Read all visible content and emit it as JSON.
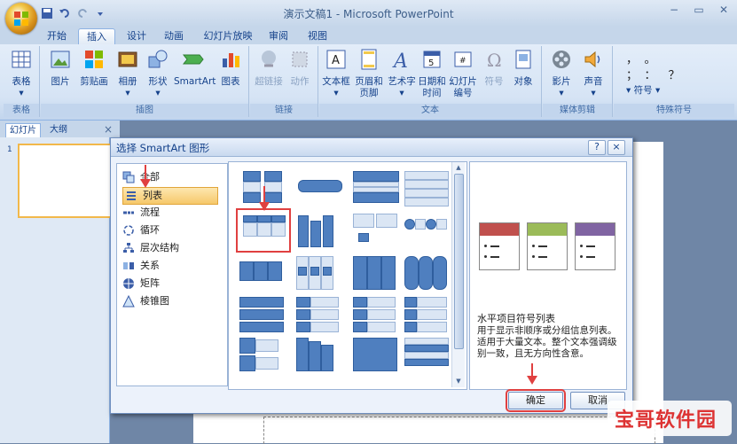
{
  "window": {
    "title": "演示文稿1 - Microsoft PowerPoint",
    "controls": [
      "−",
      "▭",
      "✕"
    ]
  },
  "tabs": [
    "开始",
    "插入",
    "设计",
    "动画",
    "幻灯片放映",
    "审阅",
    "视图"
  ],
  "ribbon": {
    "groups": [
      {
        "label": "表格",
        "buttons": [
          "表格"
        ]
      },
      {
        "label": "插图",
        "buttons": [
          "图片",
          "剪贴画",
          "相册",
          "形状",
          "SmartArt",
          "图表"
        ]
      },
      {
        "label": "链接",
        "buttons": [
          "超链接",
          "动作"
        ]
      },
      {
        "label": "文本",
        "buttons": [
          "文本框",
          "页眉和\n页脚",
          "艺术字",
          "日期和\n时间",
          "幻灯片\n编号",
          "符号",
          "对象"
        ]
      },
      {
        "label": "媒体剪辑",
        "buttons": [
          "影片",
          "声音"
        ]
      },
      {
        "label": "特殊符号",
        "buttons": [
          "符号"
        ]
      }
    ],
    "special_symbols": [
      "，",
      "。",
      "；",
      "：",
      "？"
    ]
  },
  "left_pane": {
    "tabs": [
      "幻灯片",
      "大纲"
    ],
    "close": "×",
    "slide_number": "1"
  },
  "dialog": {
    "title": "选择 SmartArt 图形",
    "help": "?",
    "close": "×",
    "categories": [
      "全部",
      "列表",
      "流程",
      "循环",
      "层次结构",
      "关系",
      "矩阵",
      "棱锥图"
    ],
    "selected_category": "列表",
    "preview": {
      "title": "水平项目符号列表",
      "description": "用于显示非顺序或分组信息列表。适用于大量文本。整个文本强调级别一致，且无方向性含意。",
      "colors": [
        "#c0504d",
        "#9bbb59",
        "#8064a2"
      ]
    },
    "ok": "确定",
    "cancel": "取消"
  },
  "watermark": "宝哥软件园",
  "colors": {
    "accent_red": "#e04040",
    "ribbon_blue": "#15428b"
  }
}
